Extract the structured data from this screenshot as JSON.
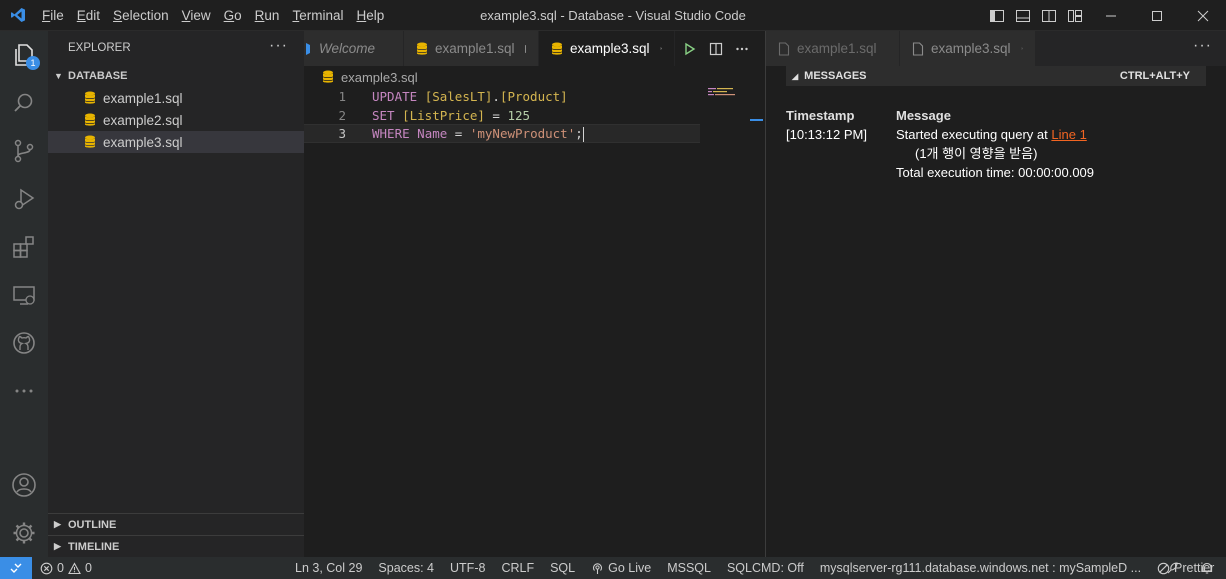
{
  "window": {
    "title": "example3.sql - Database - Visual Studio Code",
    "menu": [
      "File",
      "Edit",
      "Selection",
      "View",
      "Go",
      "Run",
      "Terminal",
      "Help"
    ]
  },
  "activity": {
    "explorer_badge": "1"
  },
  "sidebar": {
    "title": "EXPLORER",
    "folder": "DATABASE",
    "files": [
      "example1.sql",
      "example2.sql",
      "example3.sql"
    ],
    "selected_file": "example3.sql",
    "sections": [
      "OUTLINE",
      "TIMELINE"
    ]
  },
  "editor": {
    "tabs": [
      {
        "label": "Welcome",
        "state": "preview"
      },
      {
        "label": "example1.sql",
        "state": "modified"
      },
      {
        "label": "example3.sql",
        "state": "active"
      }
    ],
    "breadcrumb": "example3.sql",
    "line_numbers": [
      "1",
      "2",
      "3"
    ],
    "code": {
      "l1_kw": "UPDATE",
      "l1_schema": "[SalesLT]",
      "l1_dot": ".",
      "l1_table": "[Product]",
      "l2_kw": "SET",
      "l2_col": "[ListPrice]",
      "l2_op": " = ",
      "l2_val": "125",
      "l3_kw": "WHERE",
      "l3_col": "Name",
      "l3_op": " = ",
      "l3_val": "'myNewProduct'",
      "l3_end": ";"
    }
  },
  "results": {
    "tabs": [
      "example1.sql",
      "example3.sql"
    ],
    "messages_title": "MESSAGES",
    "shortcut": "CTRL+ALT+Y",
    "col_timestamp": "Timestamp",
    "col_message": "Message",
    "timestamp": "[10:13:12 PM]",
    "msg_started": "Started executing query at ",
    "msg_link": "Line 1",
    "msg_rows": "(1개 행이 영향을 받음)",
    "msg_time": "Total execution time: 00:00:00.009"
  },
  "status": {
    "problems": {
      "errors": "0",
      "warnings": "0"
    },
    "position": "Ln 3, Col 29",
    "spaces": "Spaces: 4",
    "encoding": "UTF-8",
    "eol": "CRLF",
    "language": "SQL",
    "golive": "Go Live",
    "dialect": "MSSQL",
    "sqlcmd": "SQLCMD: Off",
    "connection": "mysqlserver-rg111.database.windows.net : mySampleD ...",
    "prettier": "Prettier"
  },
  "colors": {
    "accent": "#3a8ee6",
    "keyword": "#c586c0",
    "bracket": "#d4b550",
    "number": "#b5cea8",
    "string": "#ce9178",
    "link": "#f26522",
    "db_icon": "#e8b400"
  }
}
